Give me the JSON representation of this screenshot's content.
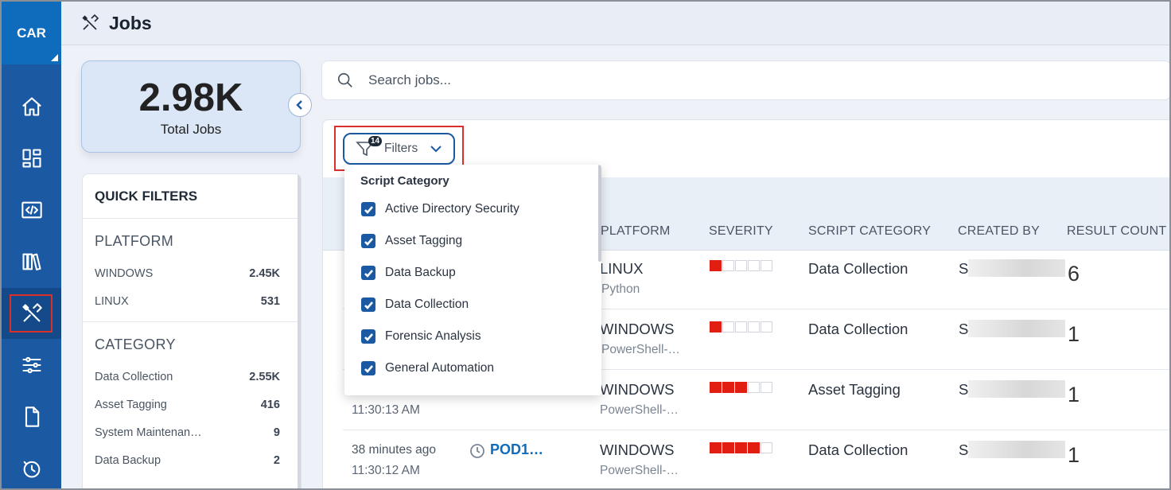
{
  "app": {
    "brand": "CAR",
    "page_title": "Jobs"
  },
  "summary": {
    "total_value": "2.98K",
    "total_label": "Total Jobs"
  },
  "quick_filters": {
    "title": "QUICK FILTERS",
    "platform": {
      "heading": "PLATFORM",
      "items": [
        {
          "label": "WINDOWS",
          "count": "2.45K"
        },
        {
          "label": "LINUX",
          "count": "531"
        }
      ]
    },
    "category": {
      "heading": "CATEGORY",
      "items": [
        {
          "label": "Data Collection",
          "count": "2.55K"
        },
        {
          "label": "Asset Tagging",
          "count": "416"
        },
        {
          "label": "System Maintenan…",
          "count": "9"
        },
        {
          "label": "Data Backup",
          "count": "2"
        }
      ]
    }
  },
  "search": {
    "placeholder": "Search jobs..."
  },
  "filters": {
    "label": "Filters",
    "badge": "14"
  },
  "dropdown": {
    "heading": "Script Category",
    "options": [
      {
        "label": "Active Directory Security",
        "checked": true
      },
      {
        "label": "Asset Tagging",
        "checked": true
      },
      {
        "label": "Data Backup",
        "checked": true
      },
      {
        "label": "Data Collection",
        "checked": true
      },
      {
        "label": "Forensic Analysis",
        "checked": true
      },
      {
        "label": "General Automation",
        "checked": true
      }
    ]
  },
  "table": {
    "columns": [
      "PLATFORM",
      "SEVERITY",
      "SCRIPT CATEGORY",
      "CREATED BY",
      "RESULT COUNT"
    ],
    "rows": [
      {
        "time": "",
        "time2": "",
        "pod": "",
        "platform": "LINUX",
        "platform_sub": "Python",
        "severity": 1,
        "category": "Data Collection",
        "created_by": "S",
        "count": "6"
      },
      {
        "time": "",
        "time2": "",
        "pod": "",
        "platform": "WINDOWS",
        "platform_sub": "PowerShell-…",
        "severity": 1,
        "category": "Data Collection",
        "created_by": "S",
        "count": "1"
      },
      {
        "time": "",
        "time2": "11:30:13 AM",
        "pod": "",
        "platform": "WINDOWS",
        "platform_sub": "PowerShell-…",
        "severity": 3,
        "category": "Asset Tagging",
        "created_by": "S",
        "count": "1"
      },
      {
        "time": "38 minutes ago",
        "time2": "11:30:12 AM",
        "pod": "POD1…",
        "platform": "WINDOWS",
        "platform_sub": "PowerShell-…",
        "severity": 4,
        "category": "Data Collection",
        "created_by": "S",
        "count": "1"
      }
    ]
  },
  "colors": {
    "rail": "#1b5aa3",
    "accent": "#0f6cbd",
    "severity_on": "#e21d12",
    "highlight": "#d9302c"
  },
  "nav_icons": [
    "home-icon",
    "dashboard-icon",
    "code-icon",
    "library-icon",
    "jobs-tools-icon",
    "settings-sliders-icon",
    "document-icon",
    "history-icon"
  ]
}
